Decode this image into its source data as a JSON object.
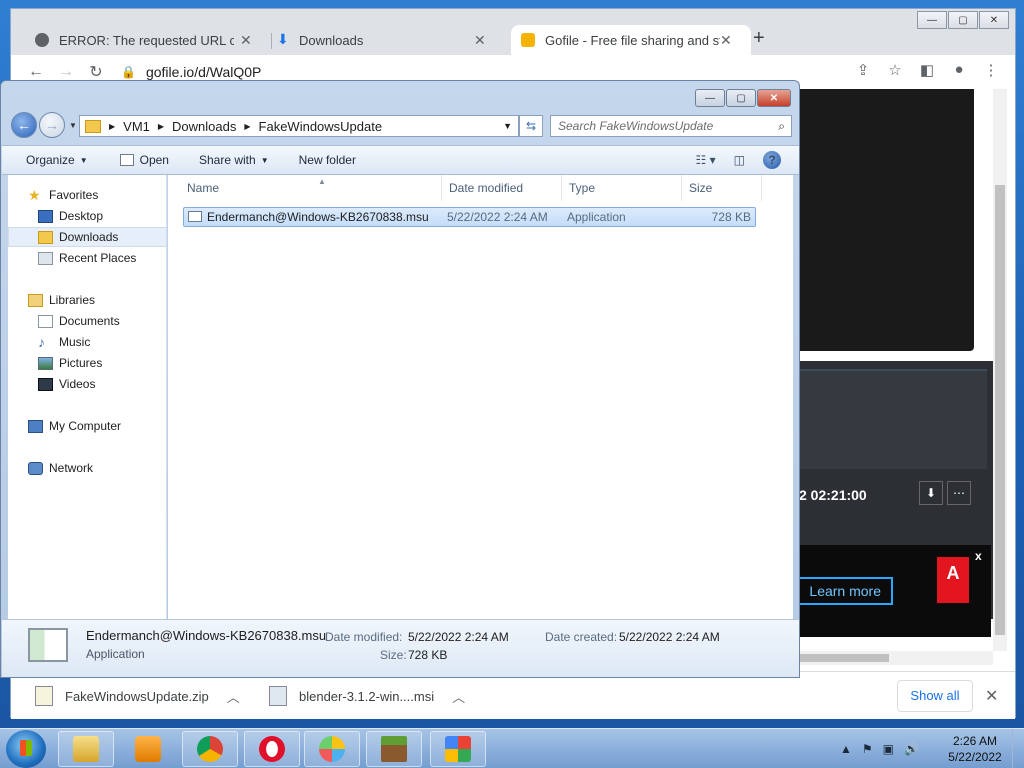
{
  "browser": {
    "tabs": [
      {
        "title": "ERROR: The requested URL could not be retrieved"
      },
      {
        "title": "Downloads"
      },
      {
        "title": "Gofile - Free file sharing and storage platform"
      }
    ],
    "url": "gofile.io/d/WalQ0P",
    "page": {
      "date_text": "2 02:21:00",
      "ad_cta": "Learn more",
      "ad_brand": "Adobe",
      "ad_close": "x"
    },
    "downloads": [
      {
        "name": "FakeWindowsUpdate.zip"
      },
      {
        "name": "blender-3.1.2-win....msi"
      }
    ],
    "show_all": "Show all"
  },
  "explorer": {
    "breadcrumb": [
      "VM1",
      "Downloads",
      "FakeWindowsUpdate"
    ],
    "search_placeholder": "Search FakeWindowsUpdate",
    "commands": {
      "organize": "Organize",
      "open": "Open",
      "share_with": "Share with",
      "new_folder": "New folder"
    },
    "nav": {
      "favorites": "Favorites",
      "desktop": "Desktop",
      "downloads": "Downloads",
      "recent_places": "Recent Places",
      "libraries": "Libraries",
      "documents": "Documents",
      "music": "Music",
      "pictures": "Pictures",
      "videos": "Videos",
      "my_computer": "My Computer",
      "network": "Network"
    },
    "columns": {
      "name": "Name",
      "date_modified": "Date modified",
      "type": "Type",
      "size": "Size"
    },
    "files": [
      {
        "name": "Endermanch@Windows-KB2670838.msu",
        "date_modified": "5/22/2022 2:24 AM",
        "type": "Application",
        "size": "728 KB"
      }
    ],
    "details": {
      "name": "Endermanch@Windows-KB2670838.msu",
      "type": "Application",
      "date_modified_label": "Date modified:",
      "date_modified": "5/22/2022 2:24 AM",
      "date_created_label": "Date created:",
      "date_created": "5/22/2022 2:24 AM",
      "size_label": "Size:",
      "size": "728 KB"
    }
  },
  "taskbar": {
    "time": "2:26 AM",
    "date": "5/22/2022"
  }
}
